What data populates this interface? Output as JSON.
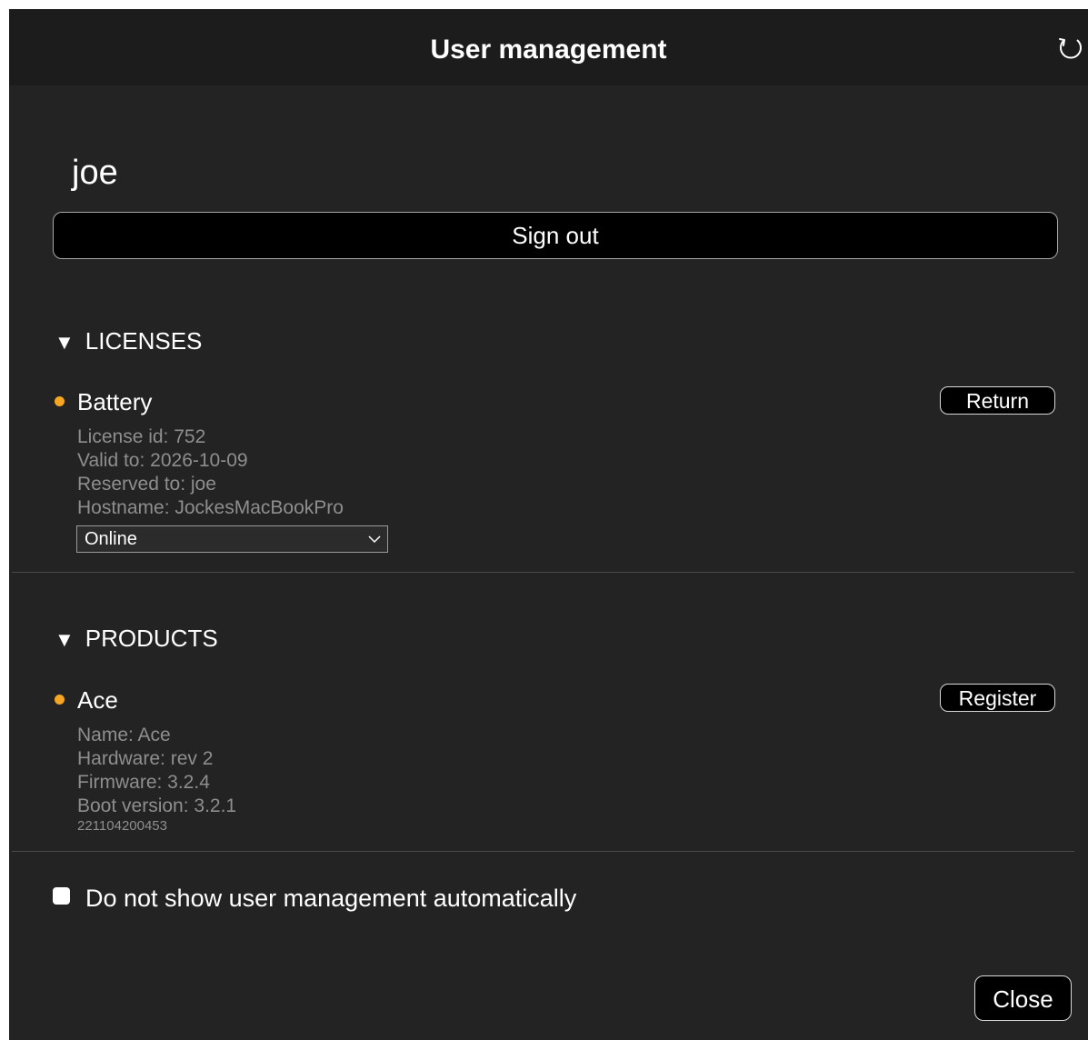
{
  "window": {
    "title": "User management",
    "refresh_icon": "refresh-icon"
  },
  "user": {
    "name": "joe",
    "signout_label": "Sign out"
  },
  "licenses": {
    "heading": "LICENSES",
    "items": [
      {
        "name": "Battery",
        "status_color": "#f5a623",
        "action_label": "Return",
        "details": [
          "License id: 752",
          "Valid to: 2026-10-09",
          "Reserved to: joe",
          "Hostname: JockesMacBookPro"
        ],
        "mode_select": {
          "selected": "Online"
        }
      }
    ]
  },
  "products": {
    "heading": "PRODUCTS",
    "items": [
      {
        "name": "Ace",
        "status_color": "#f5a623",
        "action_label": "Register",
        "details": [
          "Name: Ace",
          "Hardware: rev 2",
          "Firmware: 3.2.4",
          "Boot version: 3.2.1"
        ],
        "serial": "221104200453"
      }
    ]
  },
  "options": {
    "auto_show_label": "Do not show user management automatically",
    "auto_show_checked": false
  },
  "footer": {
    "close_label": "Close"
  }
}
